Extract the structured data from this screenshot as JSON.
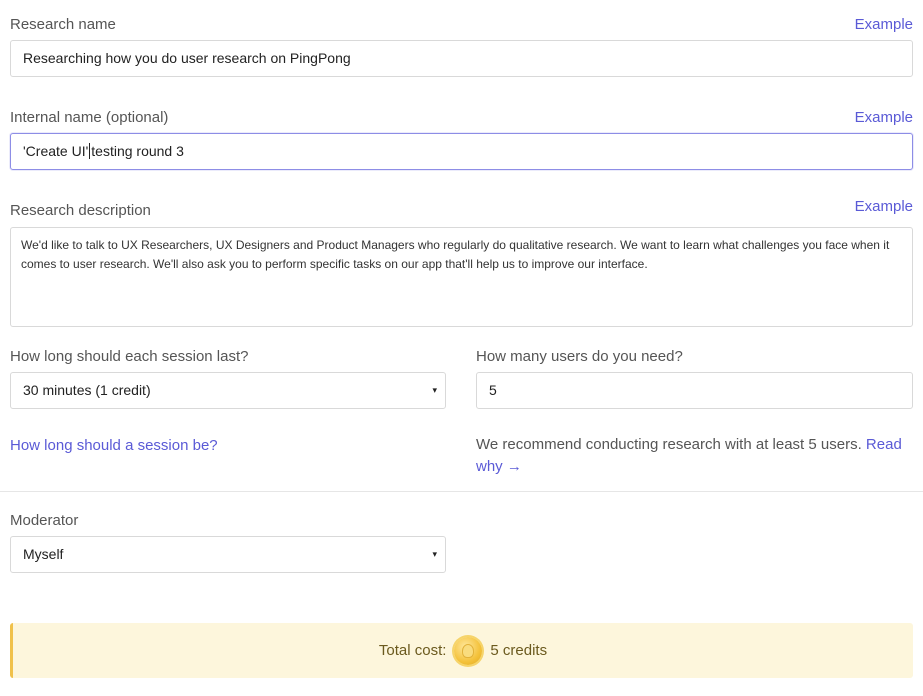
{
  "research_name": {
    "label": "Research name",
    "example": "Example",
    "value": "Researching how you do user research on PingPong"
  },
  "internal_name": {
    "label": "Internal name (optional)",
    "example": "Example",
    "value_before_cursor": "'Create UI'",
    "value_after_cursor": "testing round 3"
  },
  "description": {
    "label": "Research description",
    "example": "Example",
    "value": "We'd like to talk to UX Researchers, UX Designers and Product Managers who regularly do qualitative research. We want to learn what challenges you face when it comes to user research. We'll also ask you to perform specific tasks on our app that'll help us to improve our interface."
  },
  "session_length": {
    "label": "How long should each session last?",
    "selected": "30 minutes (1 credit)",
    "help_link": "How long should a session be?"
  },
  "users_needed": {
    "label": "How many users do you need?",
    "value": "5",
    "recommendation": "We recommend conducting research with at least 5 users.",
    "read_why": "Read why →"
  },
  "moderator": {
    "label": "Moderator",
    "selected": "Myself"
  },
  "cost": {
    "label": "Total cost:",
    "amount": "5 credits"
  },
  "icons": {
    "select_arrow": "▾",
    "coin": "credit-coin-icon"
  }
}
